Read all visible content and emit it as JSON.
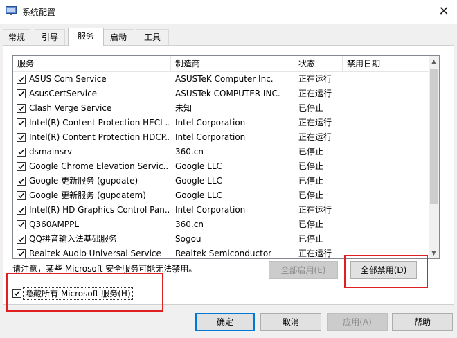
{
  "window": {
    "title": "系统配置",
    "close": "✕"
  },
  "tabs": [
    "常规",
    "引导",
    "服务",
    "启动",
    "工具"
  ],
  "columns": [
    "服务",
    "制造商",
    "状态",
    "禁用日期"
  ],
  "services": [
    {
      "name": "ASUS Com Service",
      "maker": "ASUSTeK Computer Inc.",
      "status": "正在运行"
    },
    {
      "name": "AsusCertService",
      "maker": "ASUSTek COMPUTER INC.",
      "status": "正在运行"
    },
    {
      "name": "Clash Verge Service",
      "maker": "未知",
      "status": "已停止"
    },
    {
      "name": "Intel(R) Content Protection HECI ...",
      "maker": "Intel Corporation",
      "status": "正在运行"
    },
    {
      "name": "Intel(R) Content Protection HDCP...",
      "maker": "Intel Corporation",
      "status": "正在运行"
    },
    {
      "name": "dsmainsrv",
      "maker": "360.cn",
      "status": "已停止"
    },
    {
      "name": "Google Chrome Elevation Servic...",
      "maker": "Google LLC",
      "status": "已停止"
    },
    {
      "name": "Google 更新服务 (gupdate)",
      "maker": "Google LLC",
      "status": "已停止"
    },
    {
      "name": "Google 更新服务 (gupdatem)",
      "maker": "Google LLC",
      "status": "已停止"
    },
    {
      "name": "Intel(R) HD Graphics Control Pan...",
      "maker": "Intel Corporation",
      "status": "正在运行"
    },
    {
      "name": "Q360AMPPL",
      "maker": "360.cn",
      "status": "已停止"
    },
    {
      "name": "QQ拼音输入法基础服务",
      "maker": "Sogou",
      "status": "已停止"
    },
    {
      "name": "Realtek Audio Universal Service",
      "maker": "Realtek Semiconductor",
      "status": "正在运行"
    }
  ],
  "note": "请注意，某些 Microsoft 安全服务可能无法禁用。",
  "buttons": {
    "enable_all": "全部启用(E)",
    "disable_all": "全部禁用(D)",
    "ok": "确定",
    "cancel": "取消",
    "apply": "应用(A)",
    "help": "帮助"
  },
  "hide_ms_label": "隐藏所有 Microsoft 服务(H)",
  "colors": {
    "highlight": "#e02020",
    "accent": "#0078d7"
  }
}
